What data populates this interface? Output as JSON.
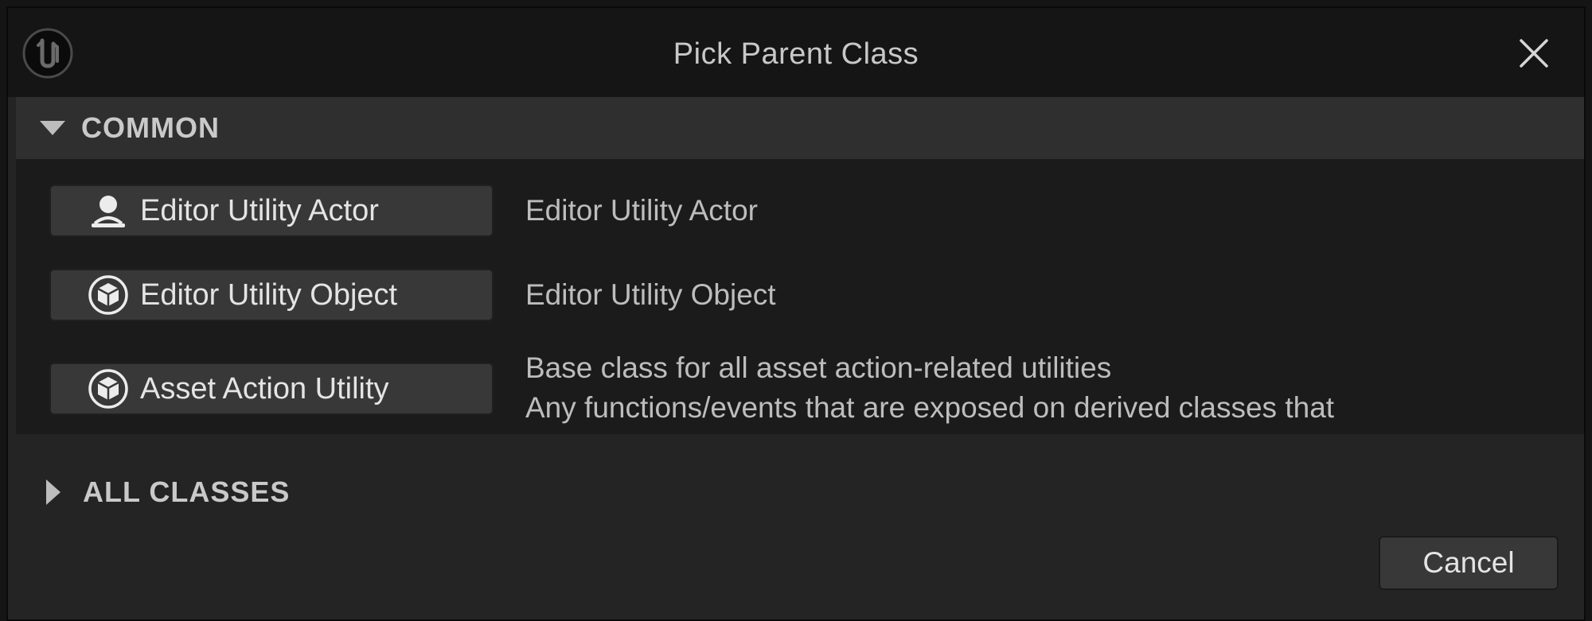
{
  "window": {
    "title": "Pick Parent Class",
    "logo_icon": "unreal-engine-logo-icon",
    "close_icon": "close-icon"
  },
  "sections": {
    "common": {
      "label": "COMMON",
      "expanded": true,
      "items": [
        {
          "button_label": "Editor Utility Actor",
          "icon": "actor-icon",
          "description_lines": [
            "Editor Utility Actor"
          ]
        },
        {
          "button_label": "Editor Utility Object",
          "icon": "object-cube-icon",
          "description_lines": [
            "Editor Utility Object"
          ]
        },
        {
          "button_label": "Asset Action Utility",
          "icon": "object-cube-icon",
          "description_lines": [
            "Base class for all asset action-related utilities",
            "Any functions/events that are exposed on derived classes that"
          ]
        }
      ]
    },
    "all_classes": {
      "label": "ALL CLASSES",
      "expanded": false
    }
  },
  "footer": {
    "cancel_label": "Cancel"
  },
  "colors": {
    "background": "#242424",
    "titlebar": "#151515",
    "button": "#383838",
    "text": "#c8c8c8"
  }
}
